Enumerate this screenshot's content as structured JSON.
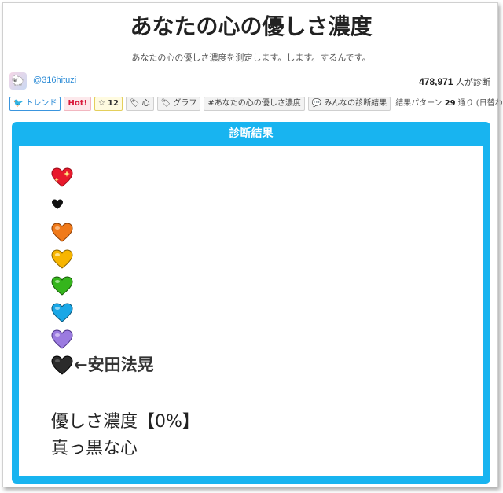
{
  "page": {
    "title": "あなたの心の優しさ濃度",
    "subtitle": "あなたの心の優しさ濃度を測定します。します。するんです。"
  },
  "author": {
    "handle": "@316hituzi",
    "avatar_icon": "sheep-avatar-icon"
  },
  "stats": {
    "diagnosed_count": "478,971",
    "diagnosed_suffix": "人が診断"
  },
  "tags": {
    "trend_label": "トレンド",
    "hot_label": "Hot!",
    "favorite_count": "12",
    "tag_1": "心",
    "tag_2": "グラフ",
    "hashtag": "#あなたの心の優しさ濃度",
    "everyone_results": "みんなの診断結果",
    "pattern_prefix": "結果パターン",
    "pattern_count": "29",
    "pattern_suffix": "通り (日替わり)"
  },
  "result": {
    "header": "診断結果",
    "hearts": [
      {
        "name": "sparkling-heart-icon",
        "color": "#e8192c"
      },
      {
        "name": "black-heart-small-icon",
        "color": "#111111"
      },
      {
        "name": "orange-heart-icon",
        "color": "#f07a1a"
      },
      {
        "name": "yellow-heart-icon",
        "color": "#f7b500"
      },
      {
        "name": "green-heart-icon",
        "color": "#35b51c"
      },
      {
        "name": "blue-heart-icon",
        "color": "#1aa7e6"
      },
      {
        "name": "purple-heart-icon",
        "color": "#9b7be0"
      },
      {
        "name": "black-heart-icon",
        "color": "#2b2b2b"
      }
    ],
    "annotation": "←安田法晃",
    "line_1": "優しさ濃度【0%】",
    "line_2": "真っ黒な心"
  },
  "colors": {
    "accent": "#18b4f0",
    "link": "#2b8bd6",
    "hot": "#d81b3c"
  }
}
